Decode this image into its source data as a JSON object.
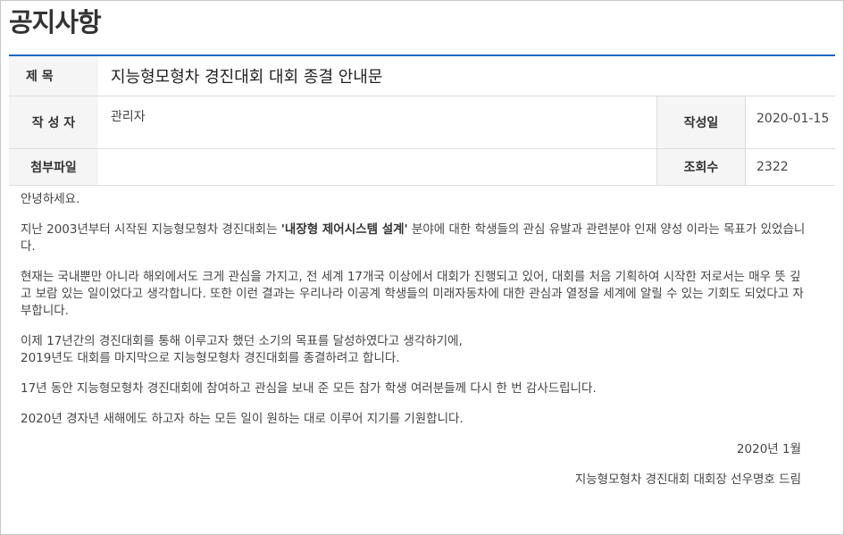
{
  "page": {
    "title": "공지사항"
  },
  "post": {
    "title_label": "제 목",
    "title": "지능형모형차 경진대회 대회 종결 안내문",
    "writer_label": "작 성 자",
    "writer": "관리자",
    "date_label": "작성일",
    "date": "2020-01-15",
    "attach_label": "첨부파일",
    "attach": "",
    "views_label": "조회수",
    "views": "2322"
  },
  "content": {
    "greeting": "안녕하세요.",
    "p1_pre": "지난 2003년부터 시작된 지능형모형차 경진대회는 ",
    "p1_bold": "'내장형 제어시스템 설계'",
    "p1_post": " 분야에 대한 학생들의 관심 유발과 관련분야 인재 양성 이라는 목표가 있었습니다.",
    "p2": "현재는 국내뿐만 아니라 해외에서도 크게 관심을 가지고, 전 세계 17개국 이상에서 대회가 진행되고 있어, 대회를 처음 기획하여 시작한 저로서는 매우 뜻 깊고 보람 있는 일이었다고 생각합니다. 또한 이런 결과는 우리나라 이공계 학생들의 미래자동차에 대한 관심과 열정을 세계에 알릴 수 있는 기회도 되었다고 자부합니다.",
    "p3_line1": "이제 17년간의 경진대회를 통해 이루고자 했던 소기의 목표를 달성하였다고 생각하기에,",
    "p3_line2": "2019년도 대회를 마지막으로 지능형모형차 경진대회를 종결하려고 합니다.",
    "p4": "17년 동안 지능형모형차 경진대회에 참여하고 관심을 보내 준 모든 참가 학생 여러분들께 다시 한 번 감사드립니다.",
    "p5": "2020년 경자년 새해에도 하고자 하는 모든 일이 원하는 대로 이루어 지기를 기원합니다.",
    "sign_date": "2020년 1월",
    "signature": "지능형모형차 경진대회 대회장 선우명호 드림"
  }
}
